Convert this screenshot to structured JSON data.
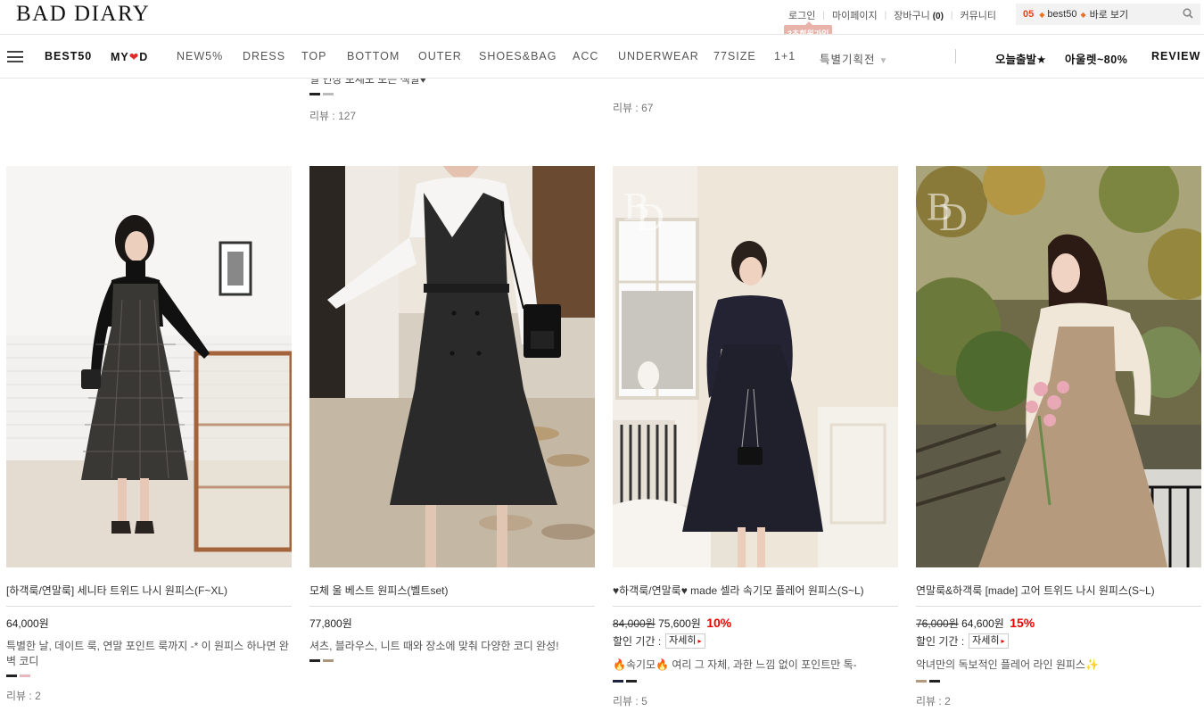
{
  "header": {
    "logo": "BAD DIARY",
    "links": {
      "login": "로그인",
      "mypage": "마이페이지",
      "cart": "장바구니",
      "cart_count": "(0)",
      "community": "커뮤니티"
    },
    "join_badge": "3초회원가입",
    "search": {
      "rank": "05",
      "keyword": "best50",
      "go": "바로 보기"
    }
  },
  "nav": {
    "items": [
      "BEST50",
      "MY",
      "D",
      "NEW5%",
      "DRESS",
      "TOP",
      "BOTTOM",
      "OUTER",
      "SHOES&BAG",
      "ACC",
      "UNDERWEAR",
      "77SIZE",
      "1+1",
      "특별기획전"
    ],
    "right": [
      "오늘출발★",
      "아울렛~80%",
      "REVIEW"
    ]
  },
  "top_row": {
    "left": {
      "desc": "일 연상 모세도 모든 색깔♥",
      "review": "리뷰 : 127"
    },
    "right": {
      "review": "리뷰 : 67"
    }
  },
  "products": [
    {
      "name": "[하객룩/연말룩] 세니타 트위드 나시 원피스(F~XL)",
      "price": "64,000원",
      "desc": "특별한 날, 데이트 룩, 연말 포인트 룩까지 -* 이 원피스 하나면 완벽 코디",
      "review": "리뷰 : 2",
      "swatches": [
        "#222222",
        "#e6b9c0"
      ]
    },
    {
      "name": "모체 울 베스트 원피스(벨트set)",
      "price": "77,800원",
      "desc": "셔츠, 블라우스, 니트 때와 장소에 맞춰 다양한 코디 완성!",
      "review": "",
      "swatches": [
        "#222222",
        "#a8977a"
      ]
    },
    {
      "name": "♥하객룩/연말룩♥ made 셀라 속기모 플레어 원피스(S~L)",
      "original_price": "84,000원",
      "price": "75,600원",
      "discount": "10%",
      "discount_label": "할인 기간 :",
      "detail_btn": "자세히",
      "desc": "🔥속기모🔥 여리 그 자체, 과한 느낌 없이 포인트만 톡-",
      "review": "리뷰 : 5",
      "swatches": [
        "#1c2340",
        "#222222"
      ]
    },
    {
      "name": "연말룩&하객룩 [made] 고어 트위드 나시 원피스(S~L)",
      "original_price": "76,000원",
      "price": "64,600원",
      "discount": "15%",
      "discount_label": "할인 기간 :",
      "detail_btn": "자세히",
      "desc": "악녀만의 독보적인 플레어 라인 원피스✨",
      "review": "리뷰 : 2",
      "swatches": [
        "#b39a7c",
        "#222222"
      ]
    }
  ]
}
